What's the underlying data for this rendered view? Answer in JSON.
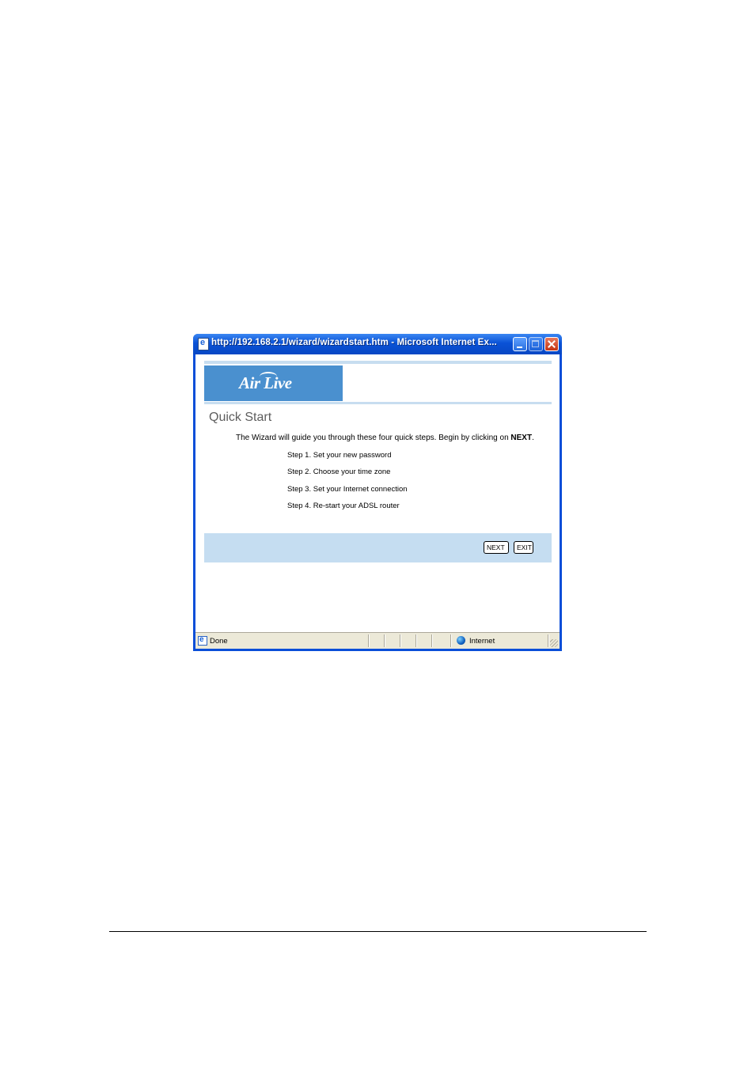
{
  "window": {
    "title": "http://192.168.2.1/wizard/wizardstart.htm - Microsoft Internet Ex..."
  },
  "brand": {
    "logo_text": "Air Live"
  },
  "page": {
    "title": "Quick Start",
    "intro_prefix": "The Wizard will guide you through these four quick steps. Begin by clicking on ",
    "intro_bold": "NEXT",
    "intro_suffix": ".",
    "steps": [
      "Step 1. Set your new password",
      "Step 2. Choose your time zone",
      "Step 3. Set your Internet connection",
      "Step 4. Re-start your ADSL router"
    ]
  },
  "buttons": {
    "next": "NEXT",
    "exit": "EXIT"
  },
  "statusbar": {
    "status": "Done",
    "zone": "Internet"
  },
  "colors": {
    "title_bar": "#0a52d6",
    "logo_bg": "#4a90cf",
    "accent_bar": "#c5ddf1"
  }
}
